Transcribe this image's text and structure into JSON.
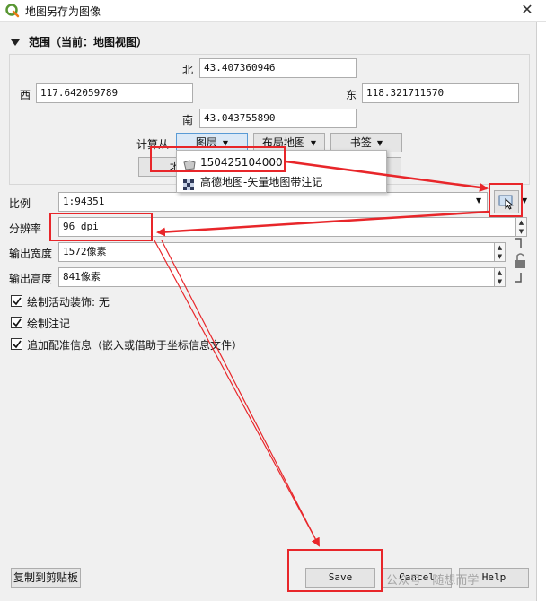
{
  "window": {
    "title": "地图另存为图像",
    "close_glyph": "✕"
  },
  "extent": {
    "title": "范围（当前：地图视图）",
    "north_label": "北",
    "north_value": "43.407360946",
    "west_label": "西",
    "west_value": "117.642059789",
    "east_label": "东",
    "east_value": "118.321711570",
    "south_label": "南",
    "south_value": "43.043755890",
    "calc_from_label": "计算从",
    "buttons": {
      "layer": "图层",
      "layout_map": "布局地图",
      "bookmark": "书签"
    },
    "hidden_button_fragment": "地"
  },
  "layer_menu": {
    "items": [
      {
        "label": "150425104000",
        "icon": "polygon-layer-icon"
      },
      {
        "label": "高德地图-矢量地图带注记",
        "icon": "raster-layer-icon"
      }
    ]
  },
  "scale": {
    "label": "比例",
    "value": "1:94351"
  },
  "resolution": {
    "label": "分辨率",
    "value": "96 dpi"
  },
  "output_width": {
    "label": "输出宽度",
    "value": "1572像素"
  },
  "output_height": {
    "label": "输出高度",
    "value": "841像素"
  },
  "checkboxes": [
    {
      "label": "绘制活动装饰: 无",
      "checked": true
    },
    {
      "label": "绘制注记",
      "checked": true
    },
    {
      "label": "追加配准信息（嵌入或借助于坐标信息文件）",
      "checked": true
    }
  ],
  "footer": {
    "copy_button": "复制到剪贴板",
    "save_button": "Save",
    "cancel_button": "Cancel",
    "help_button": "Help"
  },
  "watermark": "公众号 · 随想而学",
  "colors": {
    "annotation_red": "#e8262a",
    "qgis_green": "#589632"
  }
}
